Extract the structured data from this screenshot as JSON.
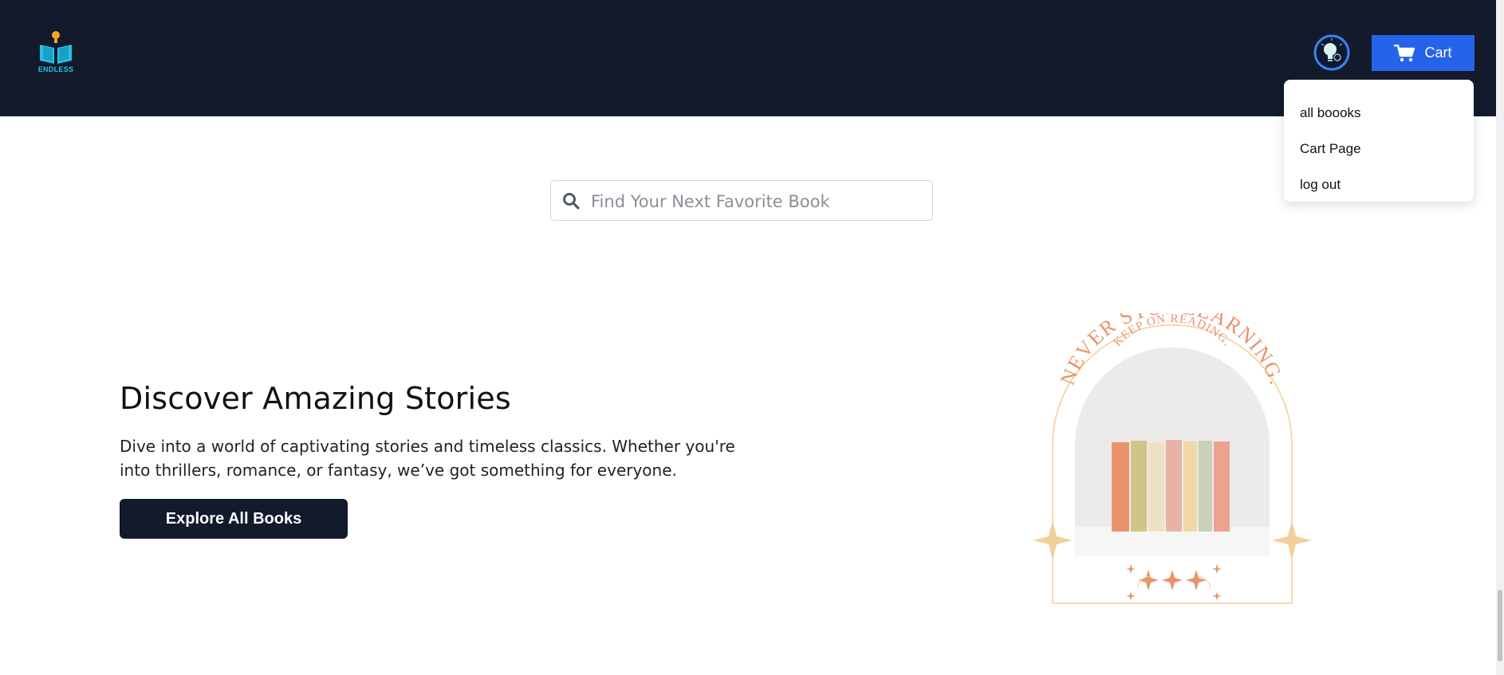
{
  "header": {
    "logo_text": "ENDLESS",
    "cart_label": "Cart",
    "avatar_icon": "lightbulb-avatar-icon",
    "cart_icon": "shopping-cart-icon"
  },
  "dropdown": {
    "items": [
      {
        "label": "all boooks"
      },
      {
        "label": "Cart Page"
      },
      {
        "label": "log out"
      }
    ]
  },
  "search": {
    "placeholder": "Find Your Next Favorite Book",
    "value": "",
    "icon": "search-icon"
  },
  "hero": {
    "title": "Discover Amazing Stories",
    "description": "Dive into a world of captivating stories and timeless classics. Whether you're into thrillers, romance, or fantasy, we’ve got something for everyone.",
    "button_label": "Explore All Books"
  },
  "illustration": {
    "top_text": "KEEP ON READING.",
    "main_text": "NEVER STOP LEARNING."
  },
  "colors": {
    "header_bg": "#121a2c",
    "accent": "#2563eb",
    "illustration_orange": "#e8936a",
    "illustration_gold": "#f3cf9a"
  }
}
